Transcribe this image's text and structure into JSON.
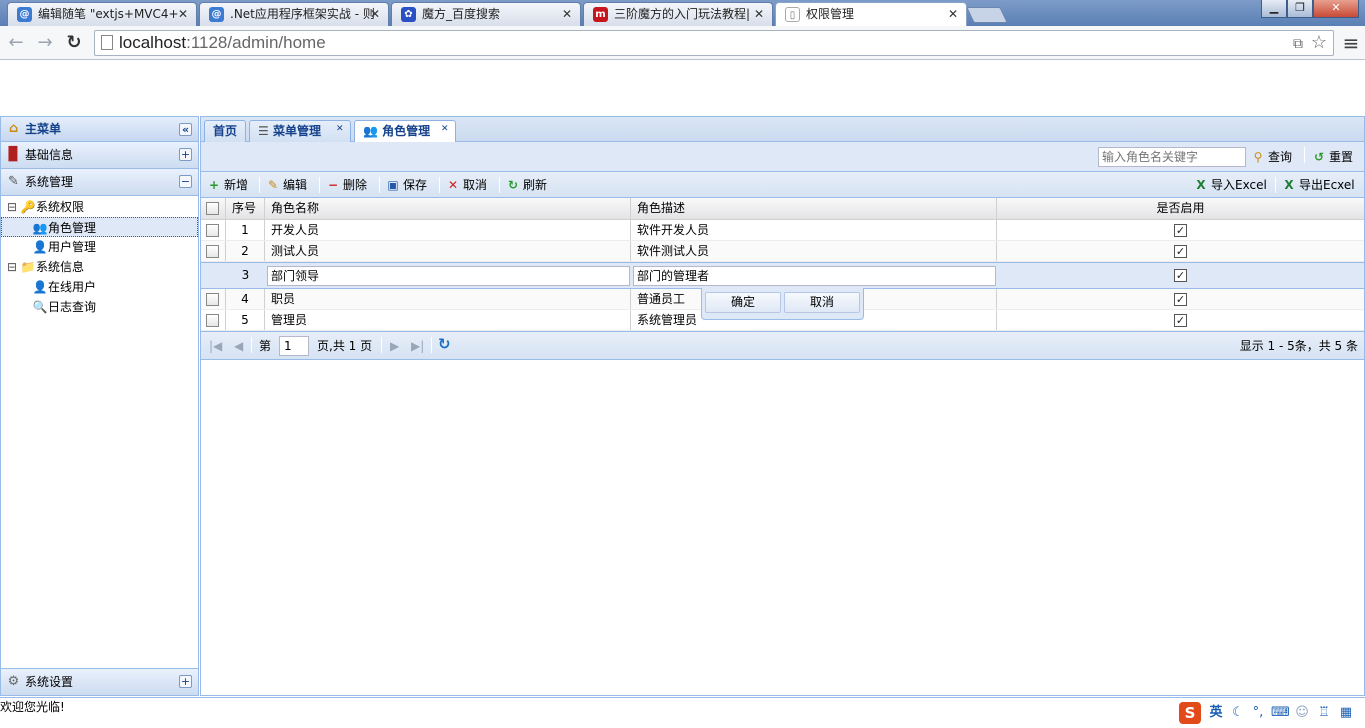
{
  "browser": {
    "tabs": [
      {
        "title": "编辑随笔 \"extjs+MVC4+",
        "fav": "@",
        "color": "#3b7bd4"
      },
      {
        "title": ".Net应用程序框架实战 - 则",
        "fav": "@",
        "color": "#3b7bd4"
      },
      {
        "title": "魔方_百度搜索",
        "fav": "✿",
        "color": "#2b4fc4"
      },
      {
        "title": "三阶魔方的入门玩法教程|",
        "fav": "m",
        "color": "#c4161c"
      },
      {
        "title": "权限管理",
        "fav": "▯",
        "color": "#ffffff"
      }
    ],
    "close_glyph": "✕",
    "window_buttons": {
      "minimize": "▁",
      "restore": "❐",
      "close": "✕"
    },
    "url_host": "localhost",
    "url_path": ":1128/admin/home",
    "back_icon": "←",
    "forward_icon": "→",
    "reload_icon": "↻",
    "menu_icon": "≡",
    "star_icon": "☆",
    "translate_icon": "⧉"
  },
  "west": {
    "title": "主菜单",
    "collapse_glyph": "«",
    "sections": [
      {
        "label": "基础信息",
        "glyph": "+"
      },
      {
        "label": "系统管理",
        "glyph": "−"
      }
    ],
    "tree": [
      {
        "label": "系统权限",
        "level": 0,
        "toggle": "⊟",
        "icon": "🔑"
      },
      {
        "label": "角色管理",
        "level": 1,
        "icon": "👥",
        "selected": true
      },
      {
        "label": "用户管理",
        "level": 1,
        "icon": "👤"
      },
      {
        "label": "系统信息",
        "level": 0,
        "toggle": "⊟",
        "icon": "📁"
      },
      {
        "label": "在线用户",
        "level": 1,
        "icon": "👤"
      },
      {
        "label": "日志查询",
        "level": 1,
        "icon": "🔍"
      }
    ],
    "footer": {
      "label": "系统设置",
      "glyph": "+"
    }
  },
  "center": {
    "tabs": [
      {
        "label": "首页",
        "closable": false
      },
      {
        "label": "菜单管理",
        "closable": true,
        "icon": "☰"
      },
      {
        "label": "角色管理",
        "closable": true,
        "icon": "👥",
        "active": true
      }
    ],
    "search": {
      "placeholder": "输入角色名关键字",
      "query_label": "查询",
      "reset_label": "重置"
    },
    "actions": [
      {
        "label": "新增",
        "icon": "+",
        "color": "#2a9a2a"
      },
      {
        "label": "编辑",
        "icon": "✎",
        "color": "#c98b10"
      },
      {
        "label": "删除",
        "icon": "−",
        "color": "#d02020"
      },
      {
        "label": "保存",
        "icon": "▣",
        "color": "#2458a8"
      },
      {
        "label": "取消",
        "icon": "✕",
        "color": "#d02020"
      },
      {
        "label": "刷新",
        "icon": "↻",
        "color": "#2a9a2a"
      }
    ],
    "import_label": "导入Excel",
    "export_label": "导出Ecxel",
    "columns": [
      "序号",
      "角色名称",
      "角色描述",
      "是否启用"
    ],
    "rows": [
      {
        "no": "1",
        "name": "开发人员",
        "desc": "软件开发人员",
        "enabled": true
      },
      {
        "no": "2",
        "name": "测试人员",
        "desc": "软件测试人员",
        "enabled": true
      },
      {
        "no": "3",
        "name": "部门领导",
        "desc": "部门的管理者",
        "enabled": true,
        "editing": true
      },
      {
        "no": "4",
        "name": "职员",
        "desc": "普通员工",
        "enabled": true
      },
      {
        "no": "5",
        "name": "管理员",
        "desc": "系统管理员",
        "enabled": true
      }
    ],
    "editor": {
      "confirm": "确定",
      "cancel": "取消"
    },
    "paging": {
      "before": "第",
      "page": "1",
      "after": "页,共 1 页",
      "summary": "显示 1 - 5条，共 5 条"
    }
  },
  "status": {
    "welcome": "欢迎您光临!",
    "ime_lang": "英"
  }
}
